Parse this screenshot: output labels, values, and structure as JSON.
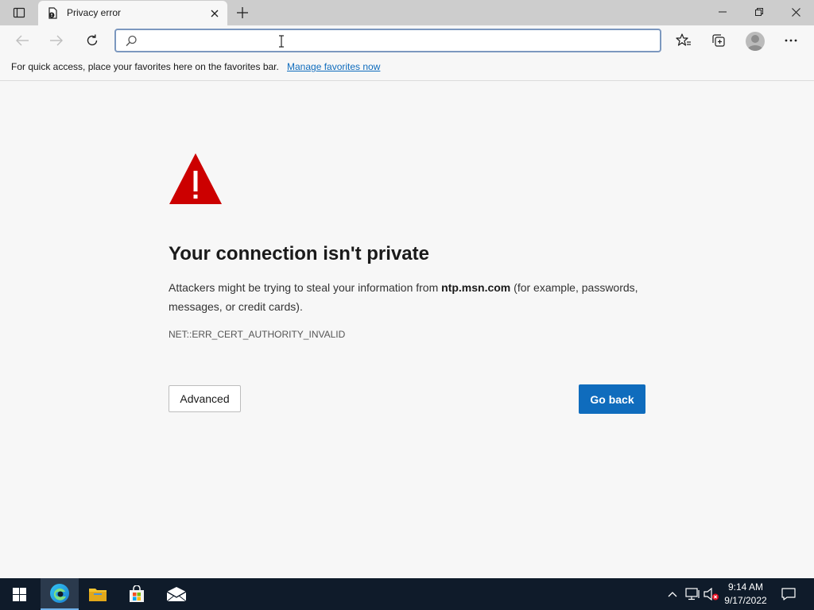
{
  "tab": {
    "title": "Privacy error"
  },
  "address": {
    "value": "",
    "placeholder": ""
  },
  "favorites_bar": {
    "message": "For quick access, place your favorites here on the favorites bar.",
    "link": "Manage favorites now"
  },
  "error": {
    "title": "Your connection isn't private",
    "desc_pre": "Attackers might be trying to steal your information from ",
    "host": "ntp.msn.com",
    "desc_post": " (for example, passwords, messages, or credit cards).",
    "code": "NET::ERR_CERT_AUTHORITY_INVALID",
    "advanced_label": "Advanced",
    "goback_label": "Go back"
  },
  "taskbar": {
    "time": "9:14 AM",
    "date": "9/17/2022"
  },
  "colors": {
    "accent": "#0f6cbd",
    "warning": "#cc0000",
    "taskbar": "#0f1b2a"
  }
}
